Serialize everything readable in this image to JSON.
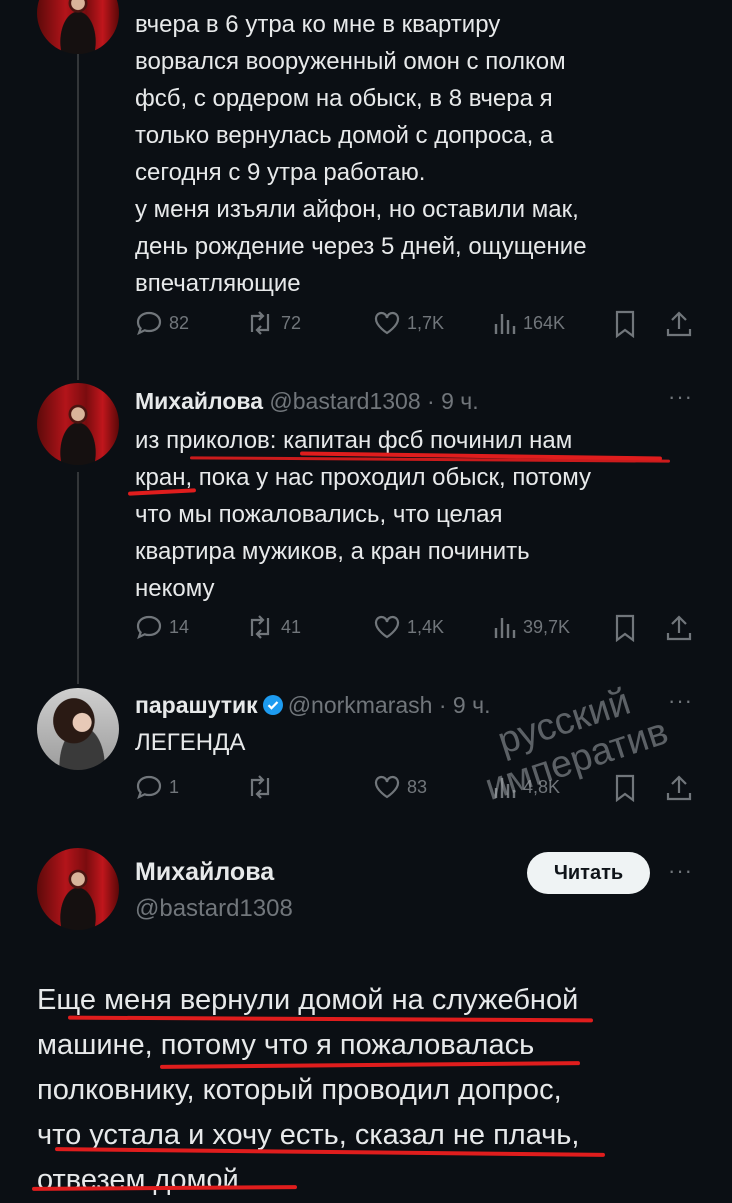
{
  "tweet1": {
    "lines": [
      "вчера в 6 утра ко мне в квартиру",
      "ворвался вооруженный омон с полком",
      "фсб, с ордером на обыск, в 8 вчера я",
      "только вернулась домой с допроса, а",
      "сегодня с 9 утра работаю.",
      "у меня изъяли айфон, но оставили мак,",
      "день рождение через 5 дней, ощущение",
      "впечатляющие"
    ],
    "replies": "82",
    "reposts": "72",
    "likes": "1,7K",
    "views": "164K"
  },
  "tweet2": {
    "name": "Михайлова",
    "handle": "@bastard1308",
    "time": "· 9 ч.",
    "lines": [
      "из приколов: капитан фсб починил нам",
      "кран, пока у нас проходил обыск, потому",
      "что мы пожаловались, что целая",
      "квартира мужиков, а кран починить",
      "некому"
    ],
    "replies": "14",
    "reposts": "41",
    "likes": "1,4K",
    "views": "39,7K"
  },
  "tweet3": {
    "name": "парашутик",
    "handle": "@norkmarash",
    "time": "· 9 ч.",
    "lines": [
      "ЛЕГЕНДА"
    ],
    "replies": "1",
    "reposts": "",
    "likes": "83",
    "views": "4,8K"
  },
  "main_tweet": {
    "name": "Михайлова",
    "handle": "@bastard1308",
    "follow_label": "Читать",
    "lines": [
      "Еще меня вернули домой на служебной",
      "машине, потому что я пожаловалась",
      "полковнику, который проводил допрос,",
      "что устала и хочу есть, сказал не плачь,",
      "отвезем домой"
    ]
  },
  "watermark": {
    "line1": "русский",
    "line2": "императив"
  },
  "colors": {
    "background": "#0b0f14",
    "text": "#e7e9ea",
    "muted": "#71767b",
    "underline": "#e01d1d",
    "verified": "#1d9bf0"
  }
}
